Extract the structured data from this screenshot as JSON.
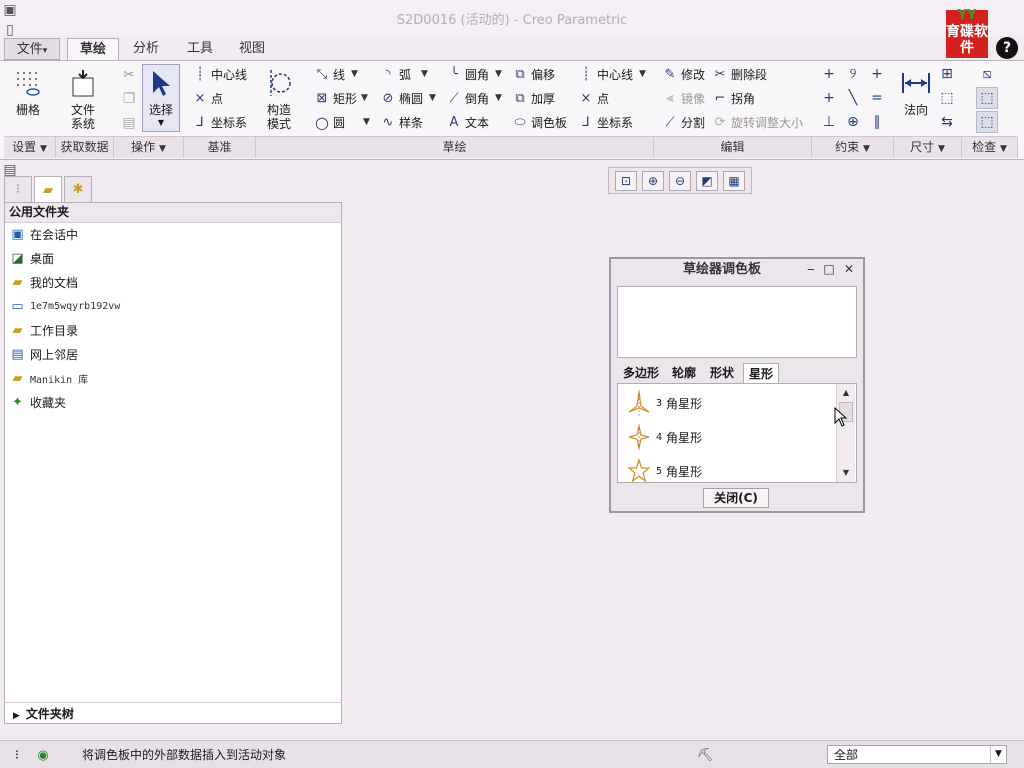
{
  "window": {
    "title": "S2D0016 (活动的) - Creo Parametric"
  },
  "quick_access": {
    "icons": [
      "app-icon",
      "new-icon",
      "open-icon",
      "save-icon",
      "undo-icon",
      "redo-icon",
      "windows-icon",
      "folder-icon",
      "customize-icon"
    ]
  },
  "logo": {
    "text_top": "YY",
    "text_main": "育碟软件"
  },
  "help": {
    "label": "?"
  },
  "tabs": [
    {
      "label": "文件",
      "dropdown": "▾"
    },
    {
      "label": "草绘"
    },
    {
      "label": "分析"
    },
    {
      "label": "工具"
    },
    {
      "label": "视图"
    }
  ],
  "ribbon": {
    "settings": {
      "grid": "栅格",
      "footer": "设置"
    },
    "get_data": {
      "file_system_line1": "文件",
      "file_system_line2": "系统",
      "footer": "获取数据"
    },
    "operations": {
      "select": "选择",
      "footer": "操作"
    },
    "datum": {
      "centerline": "中心线",
      "point": "点",
      "coordsys": "坐标系",
      "footer": "基准"
    },
    "construct": {
      "line1": "构造",
      "line2": "模式"
    },
    "sketch": {
      "line": "线",
      "rect": "矩形",
      "circle": "圆",
      "arc": "弧",
      "ellipse": "椭圆",
      "spline": "样条",
      "fillet": "圆角",
      "chamfer": "倒角",
      "text": "文本",
      "offset": "偏移",
      "thicken": "加厚",
      "palette": "调色板",
      "centerline": "中心线",
      "point": "点",
      "coordsys": "坐标系",
      "footer": "草绘"
    },
    "edit": {
      "modify": "修改",
      "delete_segment": "删除段",
      "mirror": "镜像",
      "corner": "拐角",
      "divide": "分割",
      "rotate_resize": "旋转调整大小",
      "footer": "编辑"
    },
    "constrain": {
      "footer": "约束"
    },
    "dimension": {
      "normal": "法向",
      "footer": "尺寸"
    },
    "inspect": {
      "footer": "检查"
    }
  },
  "navigator": {
    "header": "公用文件夹",
    "items": [
      {
        "label": "在会话中",
        "icon": "session-icon"
      },
      {
        "label": "桌面",
        "icon": "desktop-icon"
      },
      {
        "label": "我的文档",
        "icon": "my-documents-icon"
      },
      {
        "label": "1e7m5wqyrb192vw",
        "icon": "computer-icon"
      },
      {
        "label": "工作目录",
        "icon": "working-directory-icon"
      },
      {
        "label": "网上邻居",
        "icon": "network-icon"
      },
      {
        "label": "Manikin 库",
        "icon": "library-icon"
      },
      {
        "label": "收藏夹",
        "icon": "favorites-icon"
      }
    ],
    "footer": "文件夹树"
  },
  "palette": {
    "title": "草绘器调色板",
    "tabs": [
      "多边形",
      "轮廓",
      "形状",
      "星形"
    ],
    "active_tab": "星形",
    "items": [
      {
        "num": "3",
        "label": "角星形"
      },
      {
        "num": "4",
        "label": "角星形"
      },
      {
        "num": "5",
        "label": "角星形"
      }
    ],
    "close_label": "关闭(C)"
  },
  "status": {
    "message": "将调色板中的外部数据插入到活动对象",
    "filter_value": "全部"
  },
  "colors": {
    "star": "#d8902a",
    "accent": "#1d3a7a"
  }
}
